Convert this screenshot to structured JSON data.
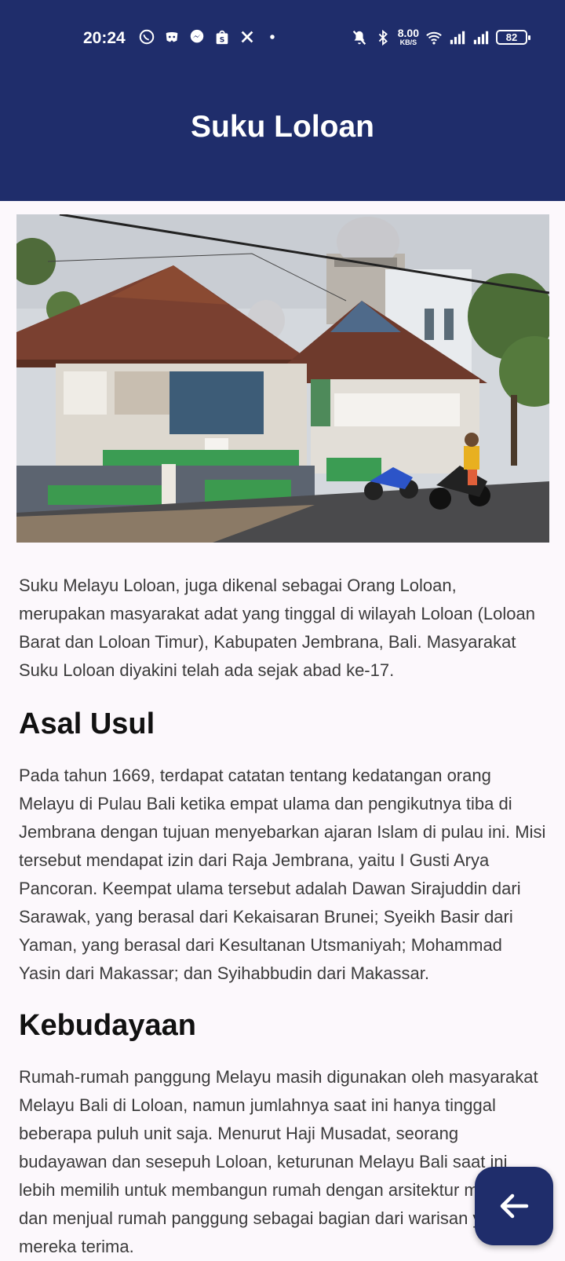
{
  "status_bar": {
    "time": "20:24",
    "net_speed_value": "8.00",
    "net_speed_unit": "KB/S",
    "battery": "82",
    "icons_left": [
      "whatsapp-icon",
      "discord-icon",
      "messenger-icon",
      "shopee-icon",
      "x-icon",
      "dot-icon"
    ],
    "icons_right": [
      "mute-icon",
      "bluetooth-icon",
      "wifi-icon",
      "signal-icon",
      "signal-icon",
      "battery-icon"
    ]
  },
  "header": {
    "title": "Suku Loloan",
    "background": "#1f2d6b"
  },
  "article": {
    "intro": "Suku Melayu Loloan, juga dikenal sebagai Orang Loloan, merupakan masyarakat adat yang tinggal di wilayah Loloan (Loloan Barat dan Loloan Timur), Kabupaten Jembrana, Bali. Masyarakat Suku Loloan diyakini telah ada sejak abad ke-17.",
    "section1_title": "Asal Usul",
    "section1_body": "Pada tahun 1669, terdapat catatan tentang kedatangan orang Melayu di Pulau Bali ketika empat ulama dan pengikutnya tiba di Jembrana dengan tujuan menyebarkan ajaran Islam di pulau ini. Misi tersebut mendapat izin dari Raja Jembrana, yaitu I Gusti Arya Pancoran. Keempat ulama tersebut adalah Dawan Sirajuddin dari Sarawak, yang berasal dari Kekaisaran Brunei; Syeikh Basir dari Yaman, yang berasal dari Kesultanan Utsmaniyah; Mohammad Yasin dari Makassar; dan Syihabbudin dari Makassar.",
    "section2_title": "Kebudayaan",
    "section2_body": "Rumah-rumah panggung Melayu masih digunakan oleh masyarakat Melayu Bali di Loloan, namun jumlahnya saat ini hanya tinggal beberapa puluh unit saja. Menurut Haji Musadat, seorang budayawan dan sesepuh Loloan, keturunan Melayu Bali saat ini lebih memilih untuk membangun rumah dengan arsitektur modern dan menjual rumah panggung sebagai bagian dari warisan yang mereka terima."
  },
  "fab": {
    "icon": "arrow-back-icon",
    "color": "#1f2d6b"
  }
}
